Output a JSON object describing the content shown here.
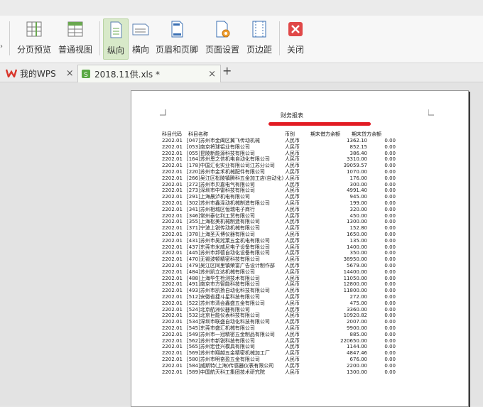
{
  "toolbar": {
    "buttons": [
      {
        "key": "page_break_preview",
        "label": "分页预览",
        "active": false
      },
      {
        "key": "normal_view",
        "label": "普通视图",
        "active": false
      },
      {
        "key": "portrait",
        "label": "纵向",
        "active": true
      },
      {
        "key": "landscape",
        "label": "横向",
        "active": false
      },
      {
        "key": "header_footer",
        "label": "页眉和页脚",
        "active": false
      },
      {
        "key": "page_setup",
        "label": "页面设置",
        "active": false
      },
      {
        "key": "margins",
        "label": "页边距",
        "active": false
      },
      {
        "key": "close",
        "label": "关闭",
        "active": false
      }
    ],
    "colors": {
      "active_bg": "#d8e9c9",
      "close_red": "#e04848",
      "icon_blue": "#3a6fb3",
      "icon_green": "#6aa84f"
    }
  },
  "tabs": {
    "wps_home_label": "我的WPS",
    "document_label": "2018.11供.xls *",
    "close_symbol": "×",
    "new_tab_symbol": "+"
  },
  "report": {
    "title": "财务报表",
    "headers": {
      "code": "科目代码",
      "name": "科目名称",
      "currency": "币别",
      "debit": "期末借方余额",
      "credit": "期末贷方余额"
    },
    "rows": [
      {
        "code": "2202.01",
        "name": "[047]苏州市金阖区翼飞传动机械",
        "currency": "人民币",
        "debit": "1362.10",
        "credit": "0.00"
      },
      {
        "code": "2202.01",
        "name": "[053]南京将球铝业有限公司",
        "currency": "人民币",
        "debit": "852.15",
        "credit": "0.00"
      },
      {
        "code": "2202.01",
        "name": "[055]昆陵新能源科技有限公司",
        "currency": "人民币",
        "debit": "386.40",
        "credit": "0.00"
      },
      {
        "code": "2202.01",
        "name": "[164]苏州恩之信机电自动化有限公司",
        "currency": "人民币",
        "debit": "3310.00",
        "credit": "0.00"
      },
      {
        "code": "2202.01",
        "name": "[178]中国汇化实业有限公司江苏分公司",
        "currency": "人民币",
        "debit": "39059.57",
        "credit": "0.00"
      },
      {
        "code": "2202.01",
        "name": "[220]苏州市金禾机械配件有限公司",
        "currency": "人民币",
        "debit": "1070.00",
        "credit": "0.00"
      },
      {
        "code": "2202.01",
        "name": "[266]吴江区松陵镇腾科五金加工店(自动化)",
        "currency": "人民币",
        "debit": "176.00",
        "credit": "0.00"
      },
      {
        "code": "2202.01",
        "name": "[272]苏州市贝嘉电气有限公司",
        "currency": "人民币",
        "debit": "300.00",
        "credit": "0.00"
      },
      {
        "code": "2202.01",
        "name": "[273]深圳市中雷科技有限公司",
        "currency": "人民币",
        "debit": "4991.40",
        "credit": "0.00"
      },
      {
        "code": "2202.01",
        "name": "[291]上海晨泸机电有限公司",
        "currency": "人民币",
        "debit": "945.00",
        "credit": "0.00"
      },
      {
        "code": "2202.01",
        "name": "[302]苏州市鑫泽动机械制造有限公司",
        "currency": "人民币",
        "debit": "199.00",
        "credit": "0.00"
      },
      {
        "code": "2202.01",
        "name": "[341]苏州相城区恒瑞电子商行",
        "currency": "人民币",
        "debit": "320.00",
        "credit": "0.00"
      },
      {
        "code": "2202.01",
        "name": "[346]常州泰亿利工贸有限公司",
        "currency": "人民币",
        "debit": "450.00",
        "credit": "0.00"
      },
      {
        "code": "2202.01",
        "name": "[355]上海松美机械制造有限公司",
        "currency": "人民币",
        "debit": "1300.00",
        "credit": "0.00"
      },
      {
        "code": "2202.01",
        "name": "[371]宁波上锐传动机械有限公司",
        "currency": "人民币",
        "debit": "152.80",
        "credit": "0.00"
      },
      {
        "code": "2202.01",
        "name": "[378]上海圣天博仪器有限公司",
        "currency": "人民币",
        "debit": "1650.00",
        "credit": "0.00"
      },
      {
        "code": "2202.01",
        "name": "[431]苏州市吴淞莱五金机电有限公司",
        "currency": "人民币",
        "debit": "135.00",
        "credit": "0.00"
      },
      {
        "code": "2202.01",
        "name": "[437]东莞市米威尼电子设备有限公司",
        "currency": "人民币",
        "debit": "1400.00",
        "credit": "0.00"
      },
      {
        "code": "2202.01",
        "name": "[445]苏州市邦德自动化设备有限公司",
        "currency": "人民币",
        "debit": "350.00",
        "credit": "0.00"
      },
      {
        "code": "2202.01",
        "name": "[470]无锡波顿精密科技有限公司",
        "currency": "人民币",
        "debit": "38950.00",
        "credit": "0.00"
      },
      {
        "code": "2202.01",
        "name": "[479]吴江区同里镇荣富广告设计制作部",
        "currency": "人民币",
        "debit": "5679.00",
        "credit": "0.00"
      },
      {
        "code": "2202.01",
        "name": "[484]苏州凯立达机械有限公司",
        "currency": "人民币",
        "debit": "14400.00",
        "credit": "0.00"
      },
      {
        "code": "2202.01",
        "name": "[488]上海华生检测技术有限公司",
        "currency": "人民币",
        "debit": "11050.00",
        "credit": "0.00"
      },
      {
        "code": "2202.01",
        "name": "[491]南京市方智能科技有限公司",
        "currency": "人民币",
        "debit": "12800.00",
        "credit": "0.00"
      },
      {
        "code": "2202.01",
        "name": "[493]苏州市凯扬自动化科技有限公司",
        "currency": "人民币",
        "debit": "11800.00",
        "credit": "0.00"
      },
      {
        "code": "2202.01",
        "name": "[512]安徽省捷斗星科技有限公司",
        "currency": "人民币",
        "debit": "272.00",
        "credit": "0.00"
      },
      {
        "code": "2202.01",
        "name": "[522]苏州市清会鑫盛五金有限公司",
        "currency": "人民币",
        "debit": "475.00",
        "credit": "0.00"
      },
      {
        "code": "2202.01",
        "name": "[524]北京航洲仪器有限公司",
        "currency": "人民币",
        "debit": "3360.00",
        "credit": "0.00"
      },
      {
        "code": "2202.01",
        "name": "[532]北京巨能仪表科技有限公司",
        "currency": "人民币",
        "debit": "10920.82",
        "credit": "0.00"
      },
      {
        "code": "2202.01",
        "name": "[534]深圳市联盛自动化科技有限公司",
        "currency": "人民币",
        "debit": "2007.00",
        "credit": "0.00"
      },
      {
        "code": "2202.01",
        "name": "[545]东莞市盛汇机械有限公司",
        "currency": "人民币",
        "debit": "9900.00",
        "credit": "0.00"
      },
      {
        "code": "2202.01",
        "name": "[549]苏州市一冠精密五金制品有限公司",
        "currency": "人民币",
        "debit": "885.00",
        "credit": "0.00"
      },
      {
        "code": "2202.01",
        "name": "[562]苏州市新锐科技有限公司",
        "currency": "人民币",
        "debit": "220650.00",
        "credit": "0.00"
      },
      {
        "code": "2202.01",
        "name": "[565]苏州宏佳兴模具有限公司",
        "currency": "人民币",
        "debit": "1144.00",
        "credit": "0.00"
      },
      {
        "code": "2202.01",
        "name": "[569]苏州市翔越五金精密机械加工厂",
        "currency": "人民币",
        "debit": "4847.46",
        "credit": "0.00"
      },
      {
        "code": "2202.01",
        "name": "[580]苏州市明奋盈五金有限公司",
        "currency": "人民币",
        "debit": "676.00",
        "credit": "0.00"
      },
      {
        "code": "2202.01",
        "name": "[584]威斯特(上海)传感器仪表有限公司",
        "currency": "人民币",
        "debit": "2200.00",
        "credit": "0.00"
      },
      {
        "code": "2202.01",
        "name": "[589]中国航天科工集团技术研究院",
        "currency": "人民币",
        "debit": "1300.00",
        "credit": "0.00"
      }
    ]
  }
}
